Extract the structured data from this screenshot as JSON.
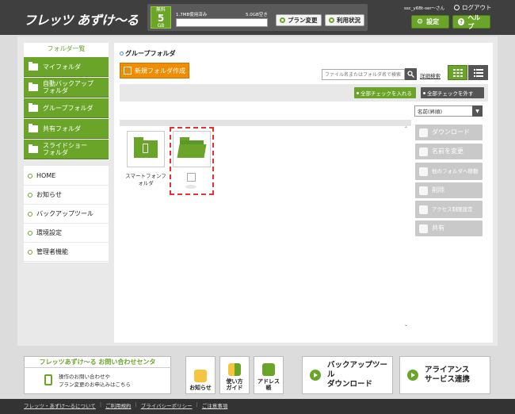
{
  "header": {
    "logo": "フレッツ あずけ〜る",
    "plan": {
      "tier": "無料",
      "size": "5",
      "unit": "GB"
    },
    "used": "1.7MB使用済み",
    "free": "5.0GB空き",
    "usage_fraction": 0.0003,
    "plan_change": "プラン変更",
    "usage_status": "利用状況",
    "user": "ssc_y6Bt-ser〜さん",
    "logout": "ログアウト",
    "settings": "設定",
    "help": "ヘルプ"
  },
  "sidebar": {
    "folder_title": "フォルダ一覧",
    "folders": [
      {
        "label": "マイフォルダ"
      },
      {
        "label": "自動バックアップ\nフォルダ"
      },
      {
        "label": "グループフォルダ"
      },
      {
        "label": "共有フォルダ"
      },
      {
        "label": "スライドショー\nフォルダ"
      }
    ],
    "nav": [
      {
        "label": "HOME"
      },
      {
        "label": "お知らせ"
      },
      {
        "label": "バックアップツール"
      },
      {
        "label": "環境設定"
      },
      {
        "label": "管理者機能"
      }
    ]
  },
  "main": {
    "breadcrumb": "グループフォルダ",
    "new_folder": "新規フォルダ作成",
    "search_placeholder": "ファイル名またはフォルダ名で検索",
    "advanced_search": "詳細検索",
    "check_all": "全部チェックを入れる",
    "uncheck_all": "全部チェックを外す",
    "sort_value": "名前(昇順)",
    "items": [
      {
        "label": "スマートフォンフォルダ"
      },
      {
        "label": ""
      }
    ],
    "actions": [
      {
        "label": "ダウンロード"
      },
      {
        "label": "名前を変更"
      },
      {
        "label": "他のフォルダへ移動"
      },
      {
        "label": "削除"
      },
      {
        "label": "アクセス制限設定"
      },
      {
        "label": "共有"
      }
    ]
  },
  "footer": {
    "contact_title": "フレッツあずけ〜る お問い合わせセンタ",
    "contact_line1": "操作のお問い合わせや",
    "contact_line2": "プラン変更のお申込みはこちら",
    "news": "お知らせ",
    "guide_line1": "使い方",
    "guide_line2": "ガイド",
    "address_line1": "アドレス",
    "address_line2": "帳",
    "backup_line1": "バックアップツール",
    "backup_line2": "ダウンロード",
    "alliance_line1": "アライアンス",
    "alliance_line2": "サービス連携",
    "links": [
      "フレッツ・あずけ〜るについて",
      "ご利用規約",
      "プライバシーポリシー",
      "ご注意事項"
    ]
  },
  "colors": {
    "accent": "#6aa52a",
    "orange": "#f08c00",
    "dark": "#3f3f3f",
    "selection": "#e53333"
  }
}
